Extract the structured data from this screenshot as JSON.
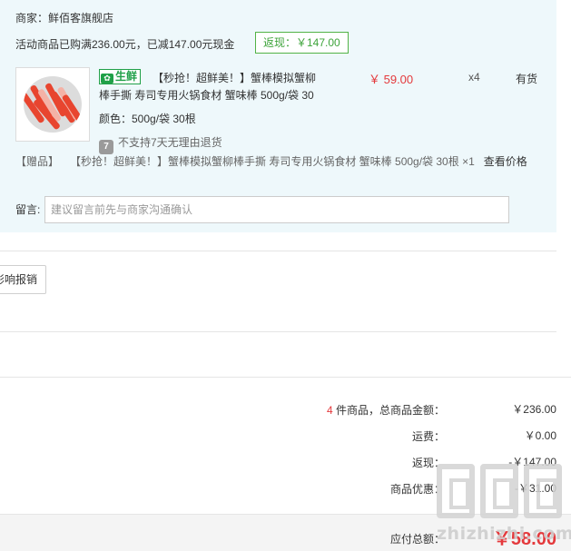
{
  "store": {
    "merchant": "商家：鲜佰客旗舰店",
    "promo": "活动商品已购满236.00元，已减147.00元现金",
    "rebate_badge": "返现：￥147.00"
  },
  "item": {
    "fresh_tag": "生鲜",
    "fresh_tag_icon": "leaf-badge-icon",
    "title_line1": "【秒抢！超鲜美！】蟹棒模拟蟹柳",
    "title_line2": "棒手撕 寿司专用火锅食材 蟹味棒 500g/袋 30",
    "price": "￥ 59.00",
    "quantity": "x4",
    "stock": "有货",
    "spec": "颜色：500g/袋 30根",
    "return_policy": "不支持7天无理由退货",
    "return_icon_text": "7"
  },
  "gift": {
    "label": "【赠品】",
    "text": "【秒抢！超鲜美！】蟹棒模拟蟹柳棒手撕 寿司专用火锅食材 蟹味棒 500g/袋 30根 ×1",
    "link": "查看价格"
  },
  "message": {
    "label": "留言:",
    "placeholder": "建议留言前先与商家沟通确认"
  },
  "impact_button": "影响报销",
  "summary": {
    "count": "4",
    "items_label": " 件商品，总商品金额：",
    "items_value": "￥236.00",
    "shipping_label": "运费：",
    "shipping_value": "￥0.00",
    "rebate_label": "返现：",
    "rebate_value": "-￥147.00",
    "discount_label": "商品优惠：",
    "discount_value": "-￥31.00",
    "payable_label": "应付总额：",
    "payable_value": "￥58.00"
  },
  "watermark": {
    "text": "zhizhizhi.com"
  },
  "colors": {
    "panel_bg": "#eef8fb",
    "price_red": "#e4393c",
    "rebate_green": "#3da33a",
    "fresh_green": "#20a048"
  }
}
